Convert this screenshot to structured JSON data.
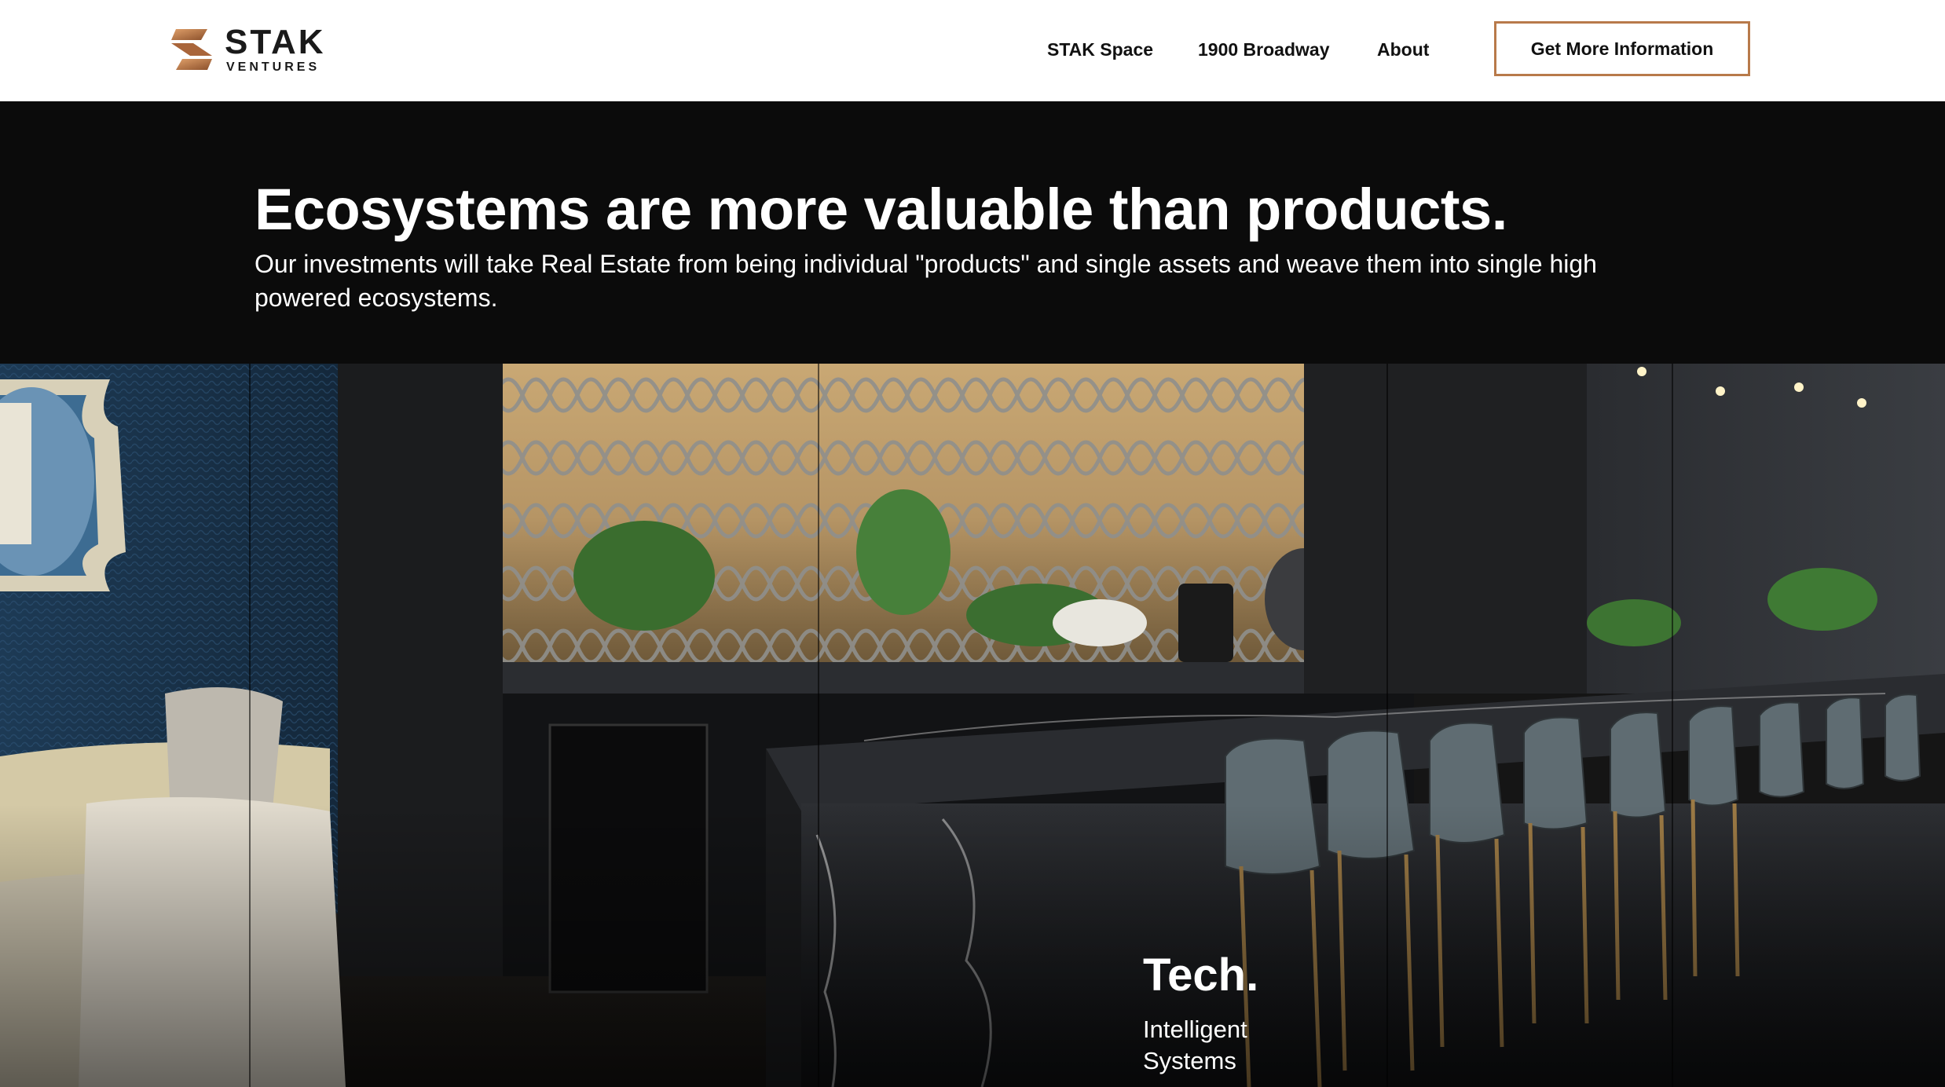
{
  "header": {
    "logo": {
      "word": "STAK",
      "sub": "VENTURES"
    },
    "nav": [
      {
        "label": "STAK Space"
      },
      {
        "label": "1900 Broadway"
      },
      {
        "label": "About"
      }
    ],
    "cta_label": "Get More Information"
  },
  "intro": {
    "headline": "Ecosystems are more valuable than products.",
    "subtext": "Our investments will take Real Estate from being individual \"products\" and single assets and weave them into single high powered ecosystems."
  },
  "hero": {
    "feature_title": "Tech.",
    "feature_desc": "Intelligent Systems"
  },
  "colors": {
    "accent": "#b87a4a",
    "header_bg": "#ffffff",
    "intro_bg": "#0b0b0b",
    "text_light": "#ffffff",
    "text_dark": "#111111"
  }
}
